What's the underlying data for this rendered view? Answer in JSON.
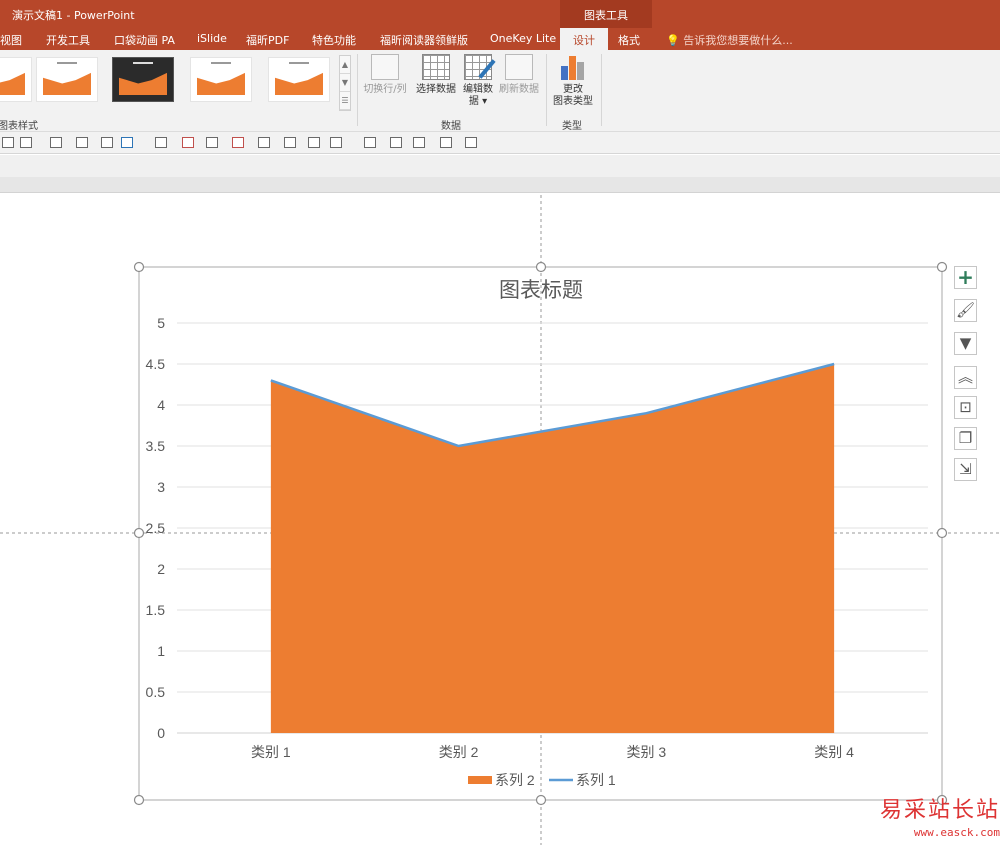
{
  "window": {
    "doc_title": "演示文稿1 - PowerPoint",
    "contextual_group": "图表工具"
  },
  "tabs": [
    {
      "label": "视图"
    },
    {
      "label": "开发工具"
    },
    {
      "label": "口袋动画 PA"
    },
    {
      "label": "iSlide"
    },
    {
      "label": "福昕PDF"
    },
    {
      "label": "特色功能"
    },
    {
      "label": "福昕阅读器领鲜版"
    },
    {
      "label": "OneKey Lite"
    },
    {
      "label": "设计"
    },
    {
      "label": "格式"
    }
  ],
  "active_tab": "设计",
  "tell_me": "告诉我您想要做什么...",
  "ribbon": {
    "styles_group_label": "图表样式",
    "data_group_label": "数据",
    "type_group_label": "类型",
    "switch_row_col": "切换行/列",
    "select_data": "选择数据",
    "edit_data_line1": "编辑数",
    "edit_data_line2": "据 ▾",
    "refresh_data": "刷新数据",
    "change_type_line1": "更改",
    "change_type_line2": "图表类型"
  },
  "colors": {
    "accent": "#b7472a",
    "series2": "#ed7d31",
    "series1": "#5b9bd5"
  },
  "side_buttons": [
    "plus-icon",
    "brush-icon",
    "filter-icon",
    "collapse-icon",
    "align-icon",
    "arrange-icon",
    "resize-icon"
  ],
  "watermark": {
    "line1": "易采站长站",
    "line2": "www.easck.com"
  },
  "chart_data": {
    "type": "area",
    "title": "图表标题",
    "categories": [
      "类别 1",
      "类别 2",
      "类别 3",
      "类别 4"
    ],
    "series": [
      {
        "name": "系列 2",
        "type": "area",
        "values": [
          4.3,
          3.5,
          3.9,
          4.5
        ]
      },
      {
        "name": "系列 1",
        "type": "line",
        "values": [
          4.3,
          3.5,
          3.9,
          4.5
        ]
      }
    ],
    "ylim": [
      0,
      5
    ],
    "yticks": [
      "0",
      "0.5",
      "1",
      "1.5",
      "2",
      "2.5",
      "3",
      "3.5",
      "4",
      "4.5",
      "5"
    ],
    "grid": true,
    "legend": "bottom"
  }
}
